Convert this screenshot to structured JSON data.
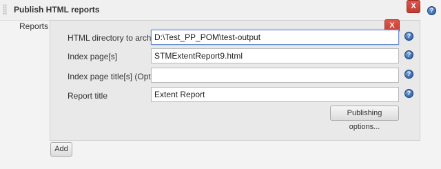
{
  "section": {
    "title": "Publish HTML reports",
    "delete_label": "X"
  },
  "reports": {
    "label": "Reports",
    "delete_label": "X",
    "fields": [
      {
        "label": "HTML directory to archive",
        "value": "D:\\Test_PP_POM\\test-output"
      },
      {
        "label": "Index page[s]",
        "value": "STMExtentReport9.html"
      },
      {
        "label": "Index page title[s] (Optional)",
        "value": ""
      },
      {
        "label": "Report title",
        "value": "Extent Report"
      }
    ],
    "publishing_options_label": "Publishing options...",
    "add_label": "Add"
  },
  "help_glyph": "?",
  "colors": {
    "delete_button": "#c9433a",
    "help_icon": "#2f64ab",
    "input_focus_border": "#6b8fc9"
  },
  "icons": [
    "grip-handle-icon",
    "help-icon"
  ]
}
